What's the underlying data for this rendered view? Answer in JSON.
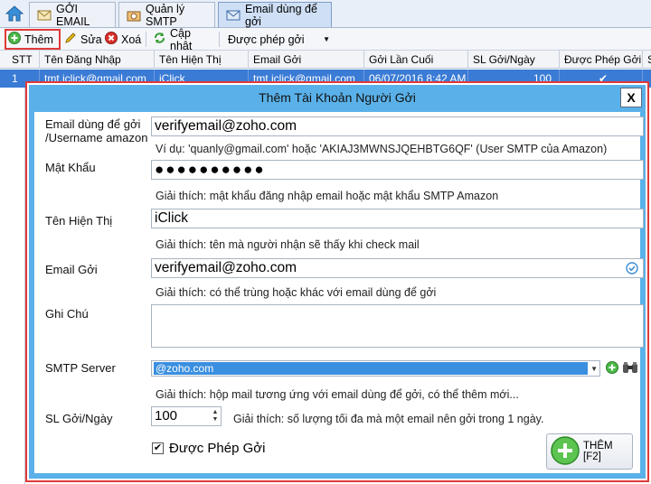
{
  "tabs": [
    {
      "label": "GỞI EMAIL",
      "icon": "email-send-icon"
    },
    {
      "label": "Quản lý SMTP",
      "icon": "smtp-server-icon"
    },
    {
      "label": "Email dùng để gởi",
      "icon": "sender-email-icon"
    }
  ],
  "toolbar": {
    "add_label": "Thêm",
    "edit_label": "Sửa",
    "delete_label": "Xoá",
    "update_label": "Cập nhật",
    "filter_value": "Được phép gởi"
  },
  "grid": {
    "columns": [
      "STT",
      "Tên Đăng Nhập",
      "Tên Hiện Thị",
      "Email Gởi",
      "Gởi Lần Cuối",
      "SL Gởi/Ngày",
      "Được Phép Gởi",
      "S"
    ],
    "row": [
      "1",
      "tmt.iclick@gmail.com",
      "iClick",
      "tmt.iclick@gmail.com",
      "06/07/2016 8:42 AM",
      "100",
      "✔",
      ""
    ]
  },
  "dialog": {
    "title": "Thêm Tài Khoản Người Gởi",
    "close_label": "X",
    "username_label": "Email dùng để gởi /Username amazon",
    "username_value": "verifyemail@zoho.com",
    "username_hint": "Ví dụ: 'quanly@gmail.com' hoặc 'AKIAJ3MWNSJQEHBTG6QF' (User SMTP của Amazon)",
    "password_label": "Mật Khẩu",
    "password_value": "●●●●●●●●●●",
    "password_hint": "Giải thích: mật khẩu đăng nhập email hoặc mật khẩu SMTP Amazon",
    "display_label": "Tên Hiện Thị",
    "display_value": "iClick",
    "display_hint": "Giải thích: tên mà người nhận sẽ thấy khi check mail",
    "sender_label": "Email Gởi",
    "sender_value": "verifyemail@zoho.com",
    "sender_hint": "Giải thích: có thể trùng hoặc khác với email dùng để gởi",
    "note_label": "Ghi Chú",
    "note_value": "",
    "smtp_label": "SMTP Server",
    "smtp_value": "@zoho.com",
    "smtp_hint": "Giải thích: hộp mail tương ứng với email dùng để gởi, có thể thêm mới...",
    "limit_label": "SL Gởi/Ngày",
    "limit_value": "100",
    "limit_hint": "Giải thích: số lượng tối đa mà một email nên gởi trong 1 ngày.",
    "allow_label": "Được Phép Gởi",
    "allow_checked": true,
    "add_button_label": "THÊM [F2]"
  },
  "colors": {
    "title_bar": "#5ab1e9",
    "highlight": "#e03a3a",
    "selection": "#3a7bd5"
  }
}
